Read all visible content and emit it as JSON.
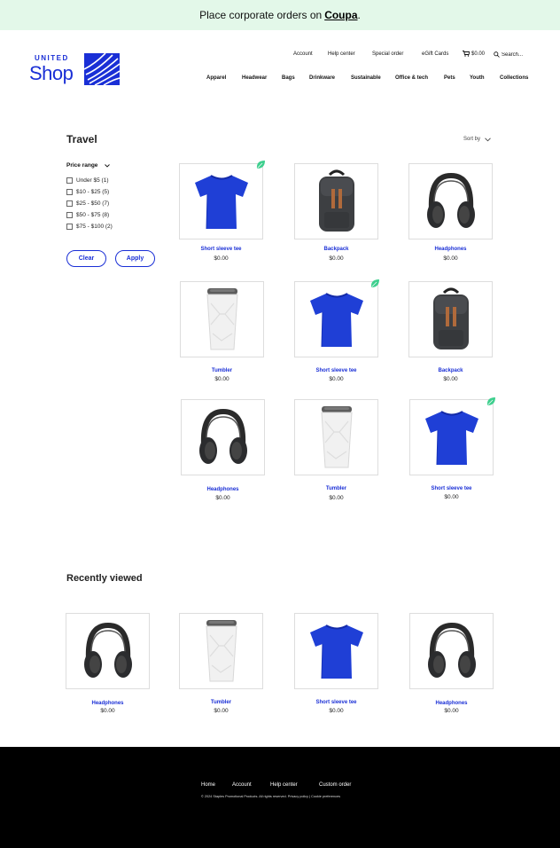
{
  "banner": {
    "text": "Place corporate orders on",
    "link": "Coupa",
    "suffix": "."
  },
  "logo": {
    "top": "UNITED",
    "main": "Shop",
    "brand_color": "#1a2fd6"
  },
  "utility_nav": {
    "account": "Account",
    "help_center": "Help center",
    "special_order": "Special order",
    "egift_cards": "eGift Cards",
    "cart_total": "$0.00",
    "search_placeholder": "Search..."
  },
  "main_nav": [
    "Apparel",
    "Headwear",
    "Bags",
    "Drinkware",
    "Sustainable",
    "Office & tech",
    "Pets",
    "Youth",
    "Collections"
  ],
  "category": {
    "title": "Travel",
    "sort_label": "Sort by"
  },
  "filters": {
    "title": "Price range",
    "options": [
      "Under $5 (1)",
      "$10 - $25 (5)",
      "$25 - $50 (7)",
      "$50 - $75 (8)",
      "$75 - $100 (2)"
    ],
    "clear_label": "Clear",
    "apply_label": "Apply"
  },
  "products": [
    {
      "name": "Short sleeve tee",
      "price": "$0.00",
      "image": "tshirt",
      "sustainable": true
    },
    {
      "name": "Backpack",
      "price": "$0.00",
      "image": "backpack",
      "sustainable": false
    },
    {
      "name": "Headphones",
      "price": "$0.00",
      "image": "headphones",
      "sustainable": false
    },
    {
      "name": "Tumbler",
      "price": "$0.00",
      "image": "tumbler",
      "sustainable": false
    },
    {
      "name": "Short sleeve tee",
      "price": "$0.00",
      "image": "tshirt",
      "sustainable": true
    },
    {
      "name": "Backpack",
      "price": "$0.00",
      "image": "backpack",
      "sustainable": false
    },
    {
      "name": "Headphones",
      "price": "$0.00",
      "image": "headphones",
      "sustainable": false
    },
    {
      "name": "Tumbler",
      "price": "$0.00",
      "image": "tumbler",
      "sustainable": false
    },
    {
      "name": "Short sleeve tee",
      "price": "$0.00",
      "image": "tshirt",
      "sustainable": true
    }
  ],
  "recently_viewed": {
    "title": "Recently viewed",
    "items": [
      {
        "name": "Headphones",
        "price": "$0.00",
        "image": "headphones"
      },
      {
        "name": "Tumbler",
        "price": "$0.00",
        "image": "tumbler"
      },
      {
        "name": "Short sleeve tee",
        "price": "$0.00",
        "image": "tshirt"
      },
      {
        "name": "Headphones",
        "price": "$0.00",
        "image": "headphones"
      }
    ]
  },
  "footer": {
    "links": [
      "Home",
      "Account",
      "Help center",
      "Custom order"
    ],
    "legal": "© 2024 Staples Promotional Products. All rights reserved. Privacy policy | Cookie preferences"
  },
  "colors": {
    "accent": "#1a2fd6",
    "banner_bg": "#e3f8e9",
    "leaf": "#3ecf8e",
    "footer_bg": "#000000"
  }
}
